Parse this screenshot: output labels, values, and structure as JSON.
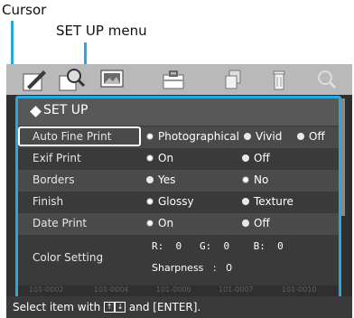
{
  "annotations": {
    "cursor_label": "Cursor",
    "menu_label": "SET UP menu"
  },
  "toolbar": {
    "icons": [
      "edit-icon",
      "search-zoom-icon",
      "image-icon",
      "toolbox-icon",
      "copy-icon",
      "trash-icon",
      "zoom-icon"
    ]
  },
  "menu": {
    "title": "SET UP",
    "rows": [
      {
        "label": "Auto Fine Print",
        "options": [
          "Photographical",
          "Vivid",
          "Off"
        ],
        "selected": 0
      },
      {
        "label": "Exif Print",
        "options": [
          "On",
          "Off"
        ],
        "selected": 0
      },
      {
        "label": "Borders",
        "options": [
          "Yes",
          "No"
        ],
        "selected": 1
      },
      {
        "label": "Finish",
        "options": [
          "Glossy",
          "Texture"
        ],
        "selected": 0
      },
      {
        "label": "Date Print",
        "options": [
          "On",
          "Off"
        ],
        "selected": 0
      }
    ],
    "color_setting": {
      "label": "Color Setting",
      "rgb": "R:  0   G:  0    B:  0",
      "sharpness": "Sharpness   :   0"
    }
  },
  "thumb_labels": [
    "101-0002",
    "101-0004",
    "101-0006",
    "101-0007",
    "101-0010"
  ],
  "status": {
    "prefix": "Select item with",
    "up": "↑",
    "down": "↓",
    "suffix": "and [ENTER]."
  },
  "colors": {
    "accent": "#29a7df",
    "screen_bg": "#2f2f2f",
    "toolbar_bg": "#b9b9b9"
  }
}
